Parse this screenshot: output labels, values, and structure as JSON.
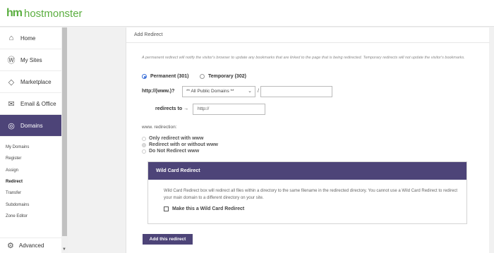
{
  "brand": {
    "mark": "hm",
    "name": "hostmonster",
    "color": "#5aae3f"
  },
  "sidebar": {
    "items": [
      {
        "label": "Home",
        "icon": "home-icon",
        "glyph": "⌂"
      },
      {
        "label": "My Sites",
        "icon": "wordpress-icon",
        "glyph": "Ⓦ"
      },
      {
        "label": "Marketplace",
        "icon": "tag-icon",
        "glyph": "◇"
      },
      {
        "label": "Email & Office",
        "icon": "envelope-icon",
        "glyph": "✉"
      },
      {
        "label": "Domains",
        "icon": "globe-icon",
        "glyph": "◎",
        "active": true
      }
    ],
    "subitems": [
      "My Domains",
      "Register",
      "Assign",
      "Redirect",
      "Transfer",
      "Subdomains",
      "Zone Editor"
    ],
    "current_subitem": "Redirect",
    "advanced": {
      "label": "Advanced",
      "icon": "gear-icon",
      "glyph": "⚙"
    },
    "accent": "#4d4478"
  },
  "panel": {
    "title": "Add Redirect",
    "intro": "A permanent redirect will notify the visitor's browser to update any bookmarks that are linked to the page that is being redirected. Temporary redirects will not update the visitor's bookmarks.",
    "type_options": [
      {
        "label": "Permanent (301)",
        "checked": true
      },
      {
        "label": "Temporary (302)",
        "checked": false
      }
    ],
    "url_prefix_label": "http://(www.)?",
    "domain_select": "** All Public Domains **",
    "slash": "/",
    "path_value": "",
    "redirects_to_label": "redirects to →",
    "redirects_to_value": "http://",
    "www_label": "www. redirection:",
    "www_options": [
      {
        "label": "Only redirect with www",
        "checked": false
      },
      {
        "label": "Redirect with or without www",
        "checked": true
      },
      {
        "label": "Do Not Redirect www",
        "checked": false
      }
    ],
    "wildcard": {
      "title": "Wild Card Redirect",
      "text": "Wild Card Redirect box will redirect all files within a directory to the same filename in the redirected directory. You cannot use a Wild Card Redirect to redirect your main domain to a different directory on your site.",
      "checkbox_label": "Make this a Wild Card Redirect",
      "checked": false
    },
    "submit_label": "Add this redirect"
  }
}
